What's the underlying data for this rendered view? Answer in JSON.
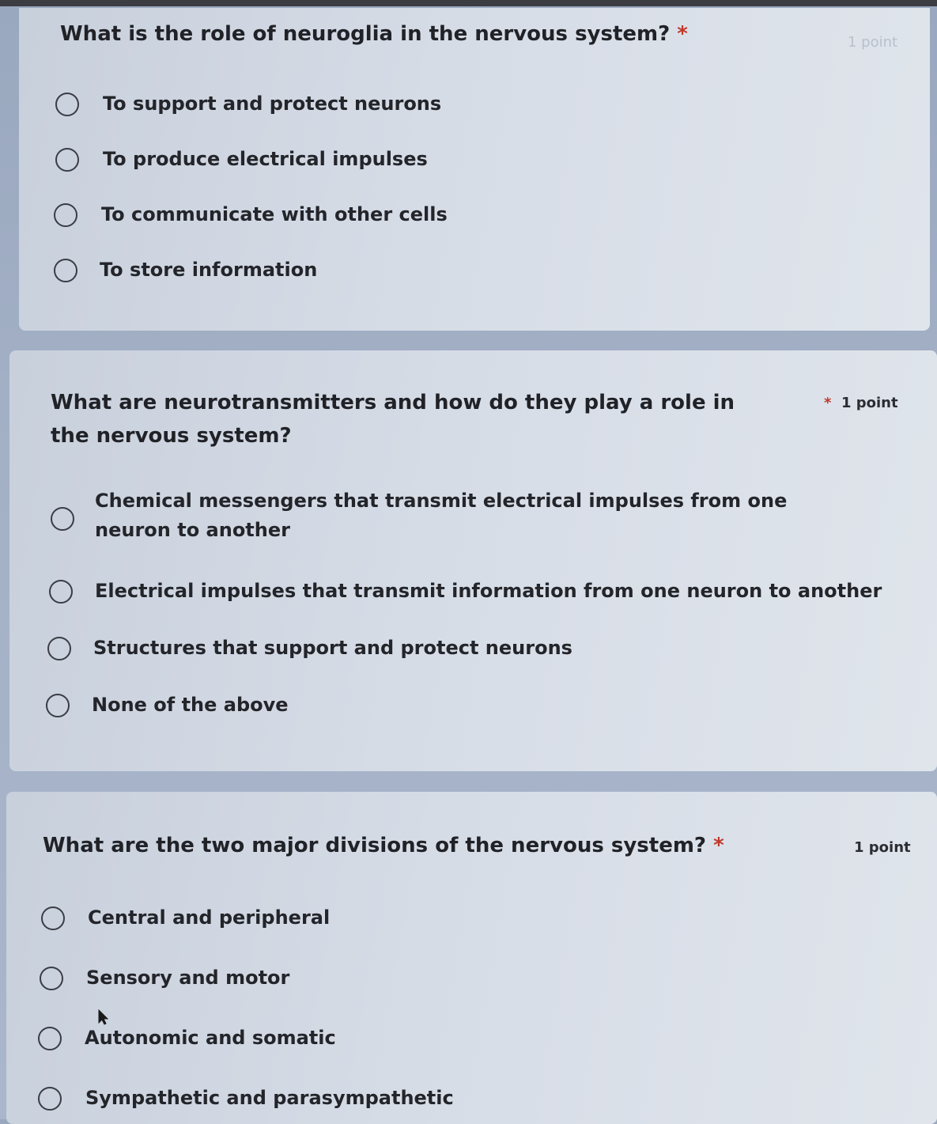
{
  "questions": [
    {
      "title": "What is the role of neuroglia in the nervous system?",
      "required_mark": "*",
      "points": "1 point",
      "options": [
        "To support and protect neurons",
        "To produce electrical impulses",
        "To communicate with other cells",
        "To store information"
      ]
    },
    {
      "title": "What are neurotransmitters and how do they play a role in the nervous system?",
      "required_mark": "*",
      "points": "1 point",
      "options": [
        "Chemical messengers that transmit electrical impulses from one neuron to another",
        "Electrical impulses that transmit information from one neuron to another",
        "Structures that support and protect neurons",
        "None of the above"
      ]
    },
    {
      "title": "What are the two major divisions of the nervous system?",
      "required_mark": "*",
      "points": "1 point",
      "options": [
        "Central and peripheral",
        "Sensory and motor",
        "Autonomic and somatic",
        "Sympathetic and parasympathetic"
      ]
    }
  ],
  "colors": {
    "background": "#a3b0c6",
    "card": "#d6dce6",
    "text": "#202227",
    "required": "#c0392b"
  }
}
